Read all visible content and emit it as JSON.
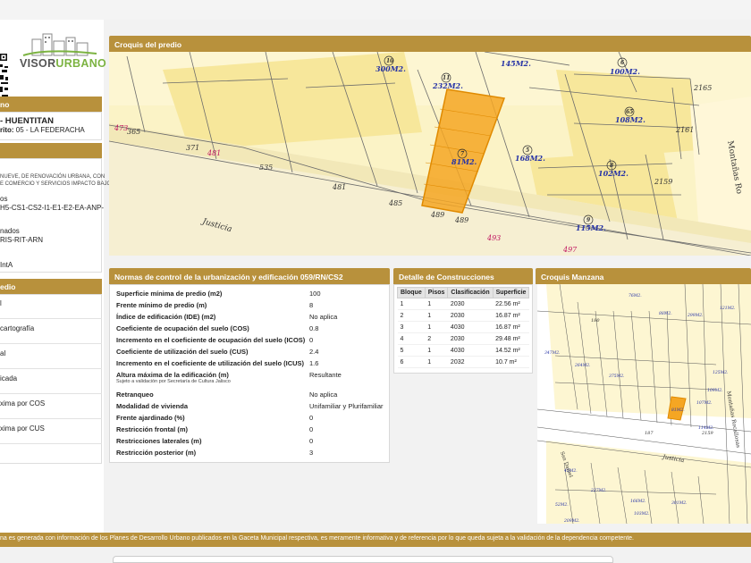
{
  "brand": {
    "name_a": "VISOR",
    "name_b": "URBANO"
  },
  "left": {
    "section1_head": "no",
    "district": "- HUENTITAN",
    "subdistrict_label": "rito:",
    "subdistrict_value": "05 - LA FEDERACHA",
    "section2_head": "",
    "desc_line1": "NUEVE, DE RENOVACIÓN URBANA, CON",
    "desc_line2": "E COMERCIO Y SERVICIOS IMPACTO BAJO",
    "codes_label": "os",
    "codes_value": "H5-CS1-CS2-I1-E1-E2-EA-ANP-",
    "assigned_label": "nados",
    "assigned_value": "RIS-RIT-ARN",
    "int_value": "IntA",
    "section3_head": "edio",
    "rows": [
      "l",
      "cartografía",
      "al",
      "icada",
      "xima por COS",
      "xima por CUS"
    ]
  },
  "croquis_predio": {
    "title": "Croquis del predio",
    "street_main": "Justicia",
    "street_side": "Montañas Ro",
    "lots": [
      {
        "num": "10",
        "area": "300M2."
      },
      {
        "num": "11",
        "area": "232M2."
      },
      {
        "num": "",
        "area": "145M2."
      },
      {
        "num": "6",
        "area": "100M2."
      },
      {
        "num": "65",
        "area": "108M2."
      },
      {
        "num": "7",
        "area": "81M2."
      },
      {
        "num": "5",
        "area": "168M2."
      },
      {
        "num": "8",
        "area": "102M2."
      },
      {
        "num": "9",
        "area": "115M2."
      }
    ],
    "house_numbers": [
      "473",
      "365",
      "371",
      "481",
      "535",
      "481",
      "485",
      "489",
      "489",
      "493",
      "497",
      "2165",
      "2161",
      "2159"
    ]
  },
  "normas": {
    "title": "Normas de control de la urbanización y edificación 059/RN/CS2",
    "rows": [
      {
        "label": "Superficie mínima de predio (m2)",
        "value": "100"
      },
      {
        "label": "Frente mínimo de predio (m)",
        "value": "8"
      },
      {
        "label": "Índice de edificación (IDE) (m2)",
        "value": "No aplica"
      },
      {
        "label": "Coeficiente de ocupación del suelo (COS)",
        "value": "0.8"
      },
      {
        "label": "Incremento en el coeficiente de ocupación del suelo (ICOS)",
        "value": "0"
      },
      {
        "label": "Coeficiente de utilización del suelo (CUS)",
        "value": "2.4"
      },
      {
        "label": "Incremento en el coeficiente de utilización del suelo (ICUS)",
        "value": "1.6"
      },
      {
        "label": "Altura máxima de la edificación (m)",
        "value": "Resultante",
        "note": "Sujeto a validación por Secretaría de Cultura Jalisco"
      },
      {
        "label": "Retranqueo",
        "value": "No aplica"
      },
      {
        "label": "Modalidad de vivienda",
        "value": "Unifamiliar y Plurifamiliar"
      },
      {
        "label": "Frente ajardinado (%)",
        "value": "0"
      },
      {
        "label": "Restricción frontal (m)",
        "value": "0"
      },
      {
        "label": "Restricciones laterales (m)",
        "value": "0"
      },
      {
        "label": "Restricción posterior (m)",
        "value": "3"
      }
    ]
  },
  "construcciones": {
    "title": "Detalle de Construcciones",
    "headers": [
      "Bloque",
      "Pisos",
      "Clasificación",
      "Superficie"
    ],
    "rows": [
      [
        "1",
        "1",
        "2030",
        "22.56 m²"
      ],
      [
        "2",
        "1",
        "2030",
        "16.87 m²"
      ],
      [
        "3",
        "1",
        "4030",
        "16.87 m²"
      ],
      [
        "4",
        "2",
        "2030",
        "29.48 m²"
      ],
      [
        "5",
        "1",
        "4030",
        "14.52 m²"
      ],
      [
        "6",
        "1",
        "2032",
        "10.7 m²"
      ]
    ]
  },
  "manzana": {
    "title": "Croquis Manzana",
    "street_a": "Justicia",
    "street_b": "San Daniel",
    "street_c": "Montañas Rocallosas"
  },
  "footer": {
    "text": "na es generada con información de los Planes de Desarrollo Urbano publicados en la Gaceta Municipal respectiva, es meramente informativa y de referencia por lo que queda sujeta a la validación de la dependencia competente."
  },
  "colors": {
    "accent": "#b8913c",
    "parcel": "#fbeea0",
    "highlight": "#f5a623",
    "line": "#6b6b6b",
    "area_text": "#2633a6",
    "house_text": "#c01560"
  }
}
